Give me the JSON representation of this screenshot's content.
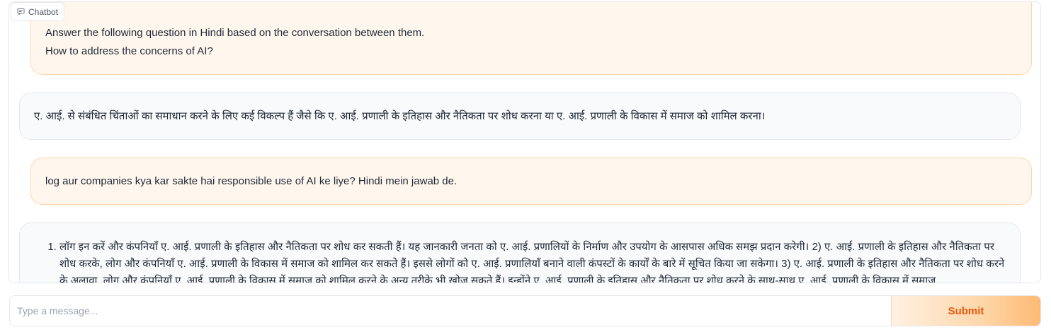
{
  "chatbot": {
    "label": "Chatbot",
    "icon": "chat-bubble-icon",
    "messages": [
      {
        "role": "user",
        "lines": [
          "Answer the following question in Hindi based on the conversation between them.",
          "How to address the concerns of AI?"
        ]
      },
      {
        "role": "bot",
        "text": "ए. आई. से संबंधित चिंताओं का समाधान करने के लिए कई विकल्प हैं जैसे कि ए. आई. प्रणाली के इतिहास और नैतिकता पर शोध करना या ए. आई. प्रणाली के विकास में समाज को शामिल करना।"
      },
      {
        "role": "user",
        "text": "log aur companies kya kar sakte hai responsible use of AI ke liye? Hindi mein jawab de."
      },
      {
        "role": "bot",
        "list_item": "लॉग इन करें और कंपनियाँ ए. आई. प्रणाली के इतिहास और नैतिकता पर शोध कर सकती हैं। यह जानकारी जनता को ए. आई. प्रणालियों के निर्माण और उपयोग के आसपास अधिक समझ प्रदान करेगी। 2) ए. आई. प्रणाली के इतिहास और नैतिकता पर शोध करके, लोग और कंपनियाँ ए. आई. प्रणाली के विकास में समाज को शामिल कर सकते हैं। इससे लोगों को ए. आई. प्रणालियाँ बनाने वाली कंपस्टों के कार्यों के बारे में सूचित किया जा सकेगा। 3) ए. आई. प्रणाली के इतिहास और नैतिकता पर शोध करने के अलावा, लोग और कंपनियाँ ए. आई. प्रणाली के विकास में समाज को शामिल करने के अन्य तरीके भी खोज सकते हैं। इन्होंने ए. आई. प्रणाली के इतिहास और नैतिकता पर शोध करने के साथ-साथ ए. आई. प्रणाली के विकास में समाज"
      }
    ]
  },
  "input": {
    "placeholder": "Type a message...",
    "value": ""
  },
  "submit": {
    "label": "Submit"
  },
  "colors": {
    "user_bubble": "#fff7ed",
    "user_border": "#fed7aa",
    "bot_bubble": "#f9fafb",
    "accent": "#ea580c"
  }
}
